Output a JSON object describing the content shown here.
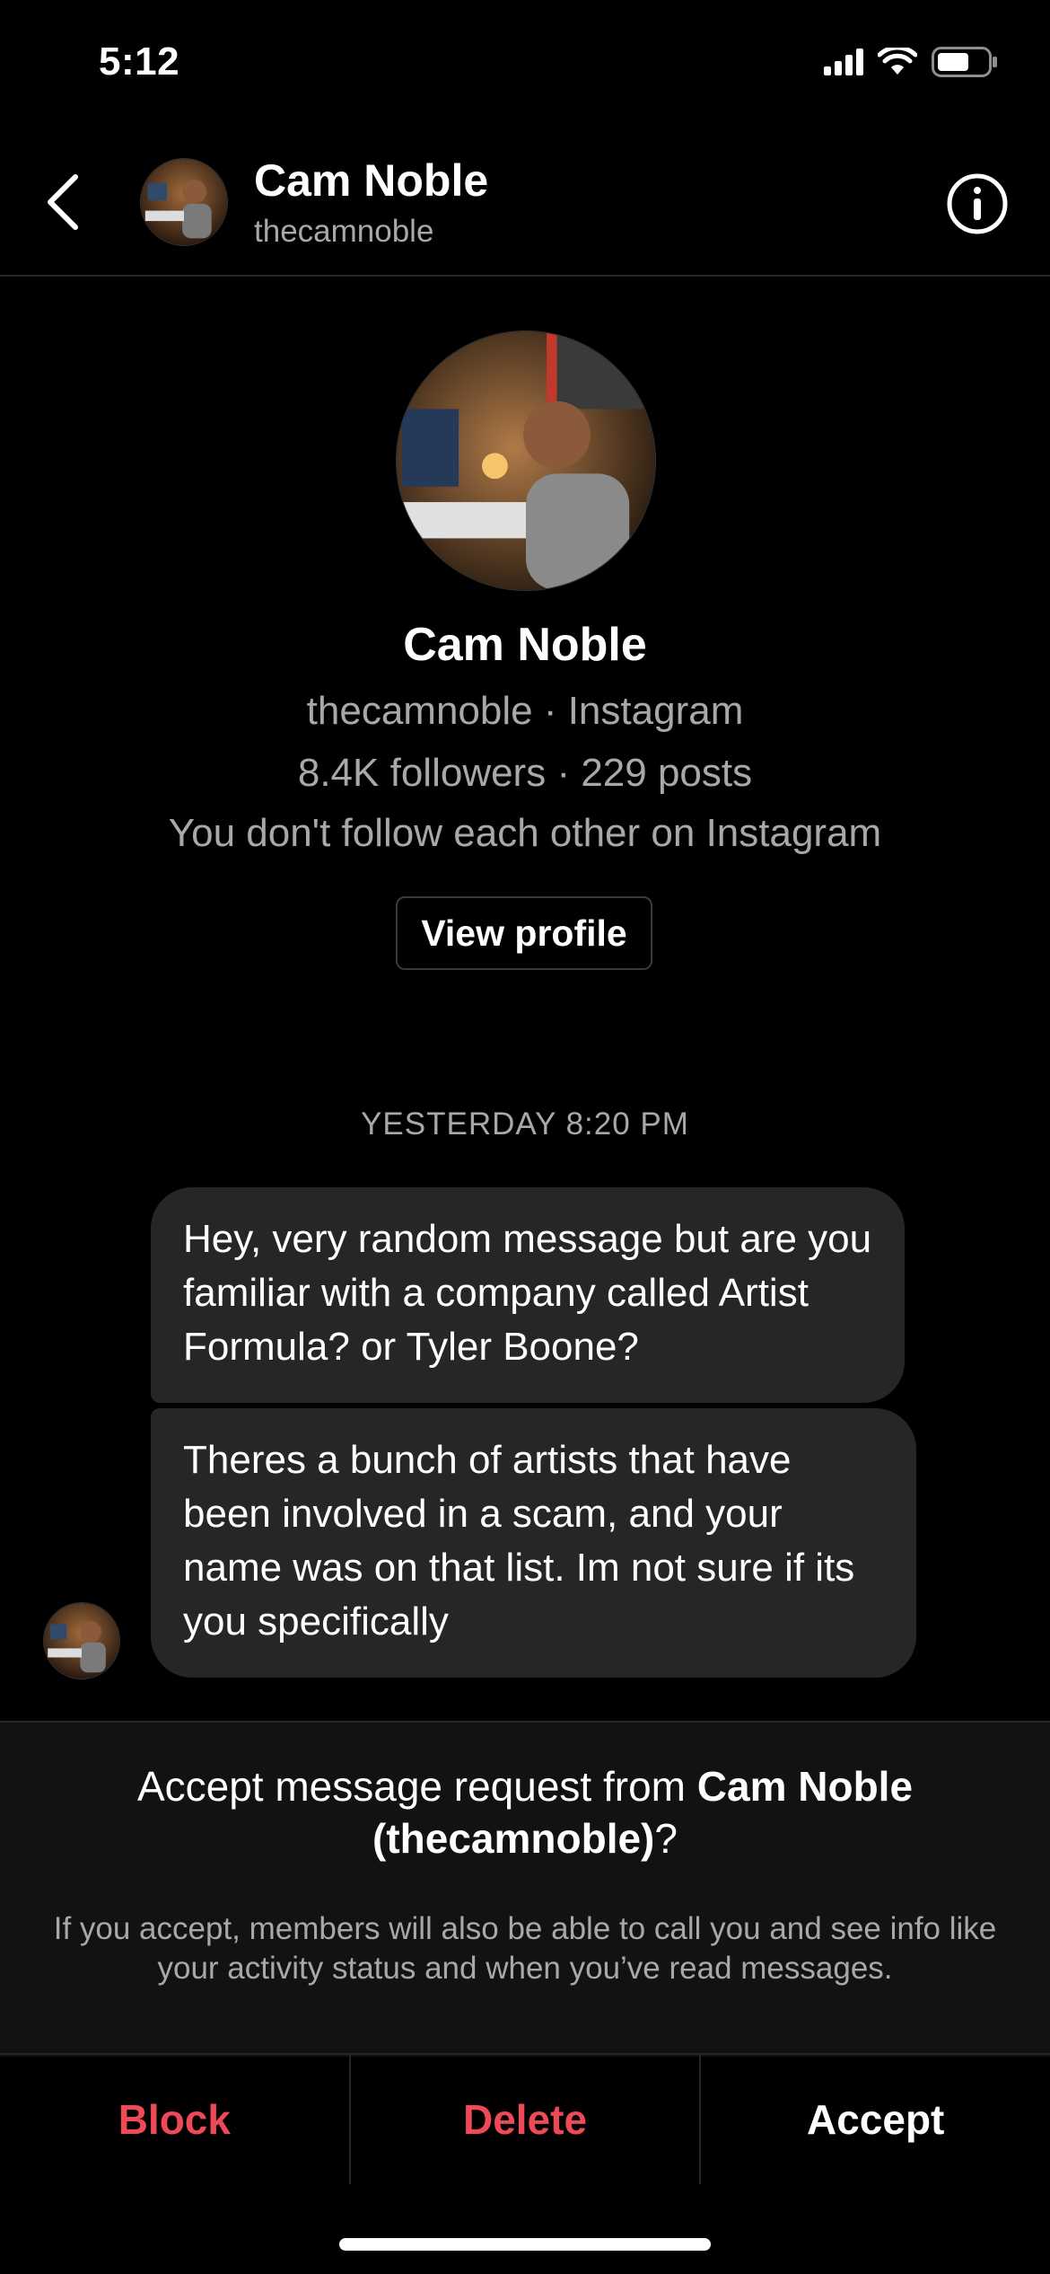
{
  "status_bar": {
    "time": "5:12"
  },
  "header": {
    "name": "Cam Noble",
    "handle": "thecamnoble"
  },
  "profile": {
    "name": "Cam Noble",
    "line1": "thecamnoble · Instagram",
    "line2": "8.4K followers · 229 posts",
    "line3": "You don't follow each other on Instagram",
    "view_profile_label": "View profile"
  },
  "thread": {
    "timestamp": "YESTERDAY 8:20 PM",
    "messages": [
      {
        "text": "Hey, very random message but are you familiar with a company called Artist Formula? or Tyler Boone?"
      },
      {
        "text": "Theres a bunch of artists that have been involved in a scam, and your name was on that list. Im not sure if its you specifically"
      }
    ]
  },
  "request": {
    "title_prefix": "Accept message request from ",
    "title_name": "Cam Noble (thecamnoble)",
    "title_suffix": "?",
    "description": "If you accept, members will also be able to call you and see info like your activity status and when you’ve read messages."
  },
  "actions": {
    "block": "Block",
    "delete": "Delete",
    "accept": "Accept"
  },
  "colors": {
    "destructive": "#ed4956",
    "bubble": "#262626",
    "background": "#000000"
  },
  "icons": {
    "back": "chevron-left-icon",
    "info": "info-icon",
    "signal": "signal-icon",
    "wifi": "wifi-icon",
    "battery": "battery-icon"
  }
}
